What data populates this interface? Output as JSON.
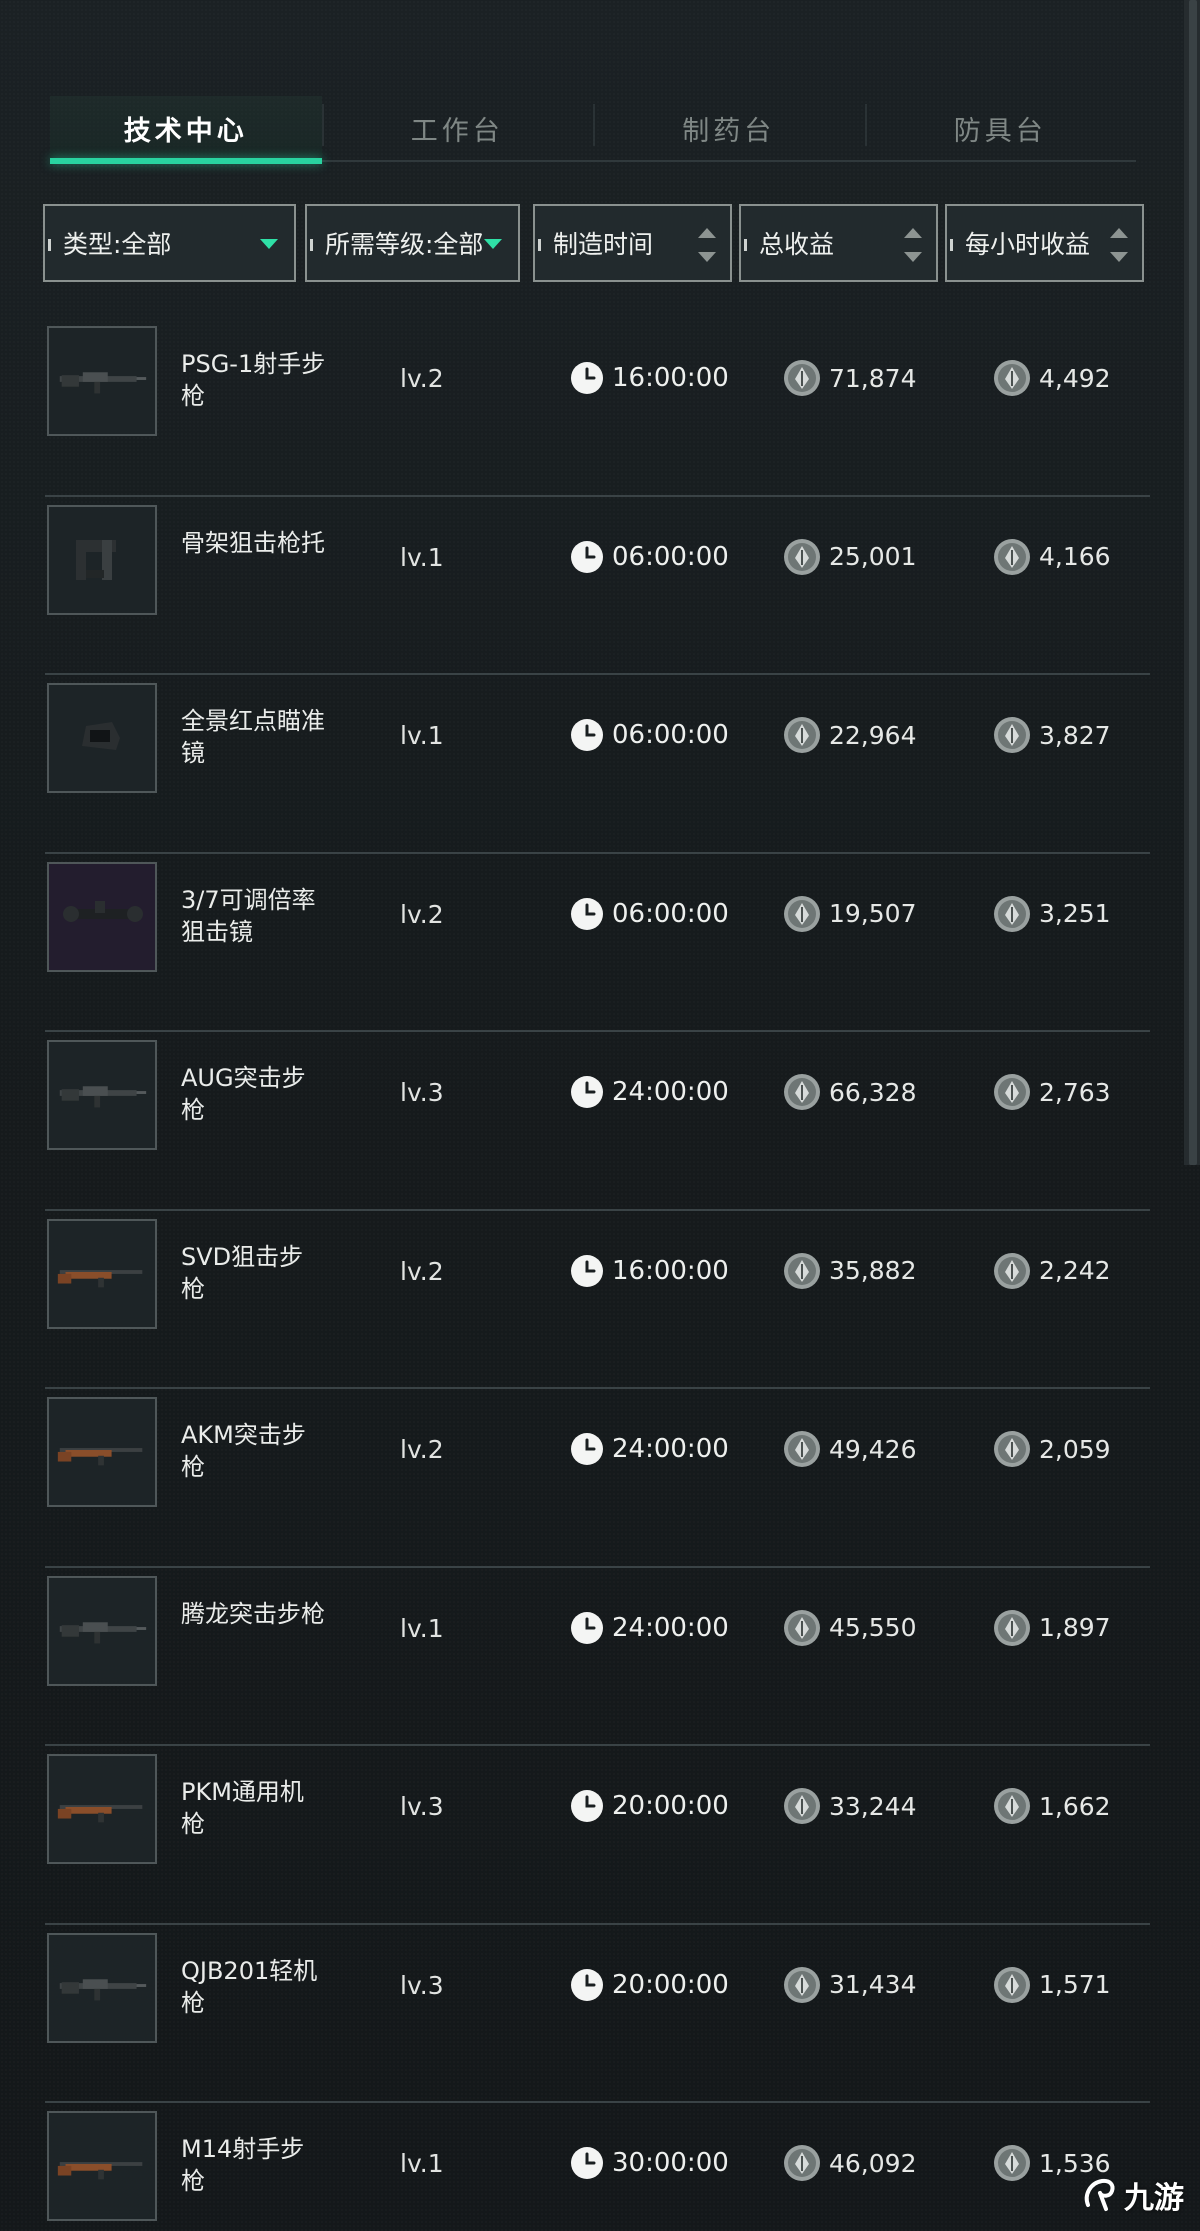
{
  "tabs": [
    {
      "label": "技术中心",
      "active": true
    },
    {
      "label": "工作台",
      "active": false
    },
    {
      "label": "制药台",
      "active": false
    },
    {
      "label": "防具台",
      "active": false
    }
  ],
  "filters": {
    "type": "类型:全部",
    "level": "所需等级:全部",
    "time": "制造时间",
    "total": "总收益",
    "hourly": "每小时收益"
  },
  "accent_color": "#29d3a0",
  "items": [
    {
      "name": "PSG-1射手步枪",
      "level": "lv.2",
      "time": "16:00:00",
      "total": "71,874",
      "hourly": "4,492",
      "icon": "psg1-rifle-icon"
    },
    {
      "name": "骨架狙击枪托",
      "level": "lv.1",
      "time": "06:00:00",
      "total": "25,001",
      "hourly": "4,166",
      "icon": "skeleton-stock-icon"
    },
    {
      "name": "全景红点瞄准镜",
      "level": "lv.1",
      "time": "06:00:00",
      "total": "22,964",
      "hourly": "3,827",
      "icon": "red-dot-sight-icon"
    },
    {
      "name": "3/7可调倍率狙击镜",
      "level": "lv.2",
      "time": "06:00:00",
      "total": "19,507",
      "hourly": "3,251",
      "icon": "sniper-scope-icon"
    },
    {
      "name": "AUG突击步枪",
      "level": "lv.3",
      "time": "24:00:00",
      "total": "66,328",
      "hourly": "2,763",
      "icon": "aug-rifle-icon"
    },
    {
      "name": "SVD狙击步枪",
      "level": "lv.2",
      "time": "16:00:00",
      "total": "35,882",
      "hourly": "2,242",
      "icon": "svd-rifle-icon"
    },
    {
      "name": "AKM突击步枪",
      "level": "lv.2",
      "time": "24:00:00",
      "total": "49,426",
      "hourly": "2,059",
      "icon": "akm-rifle-icon"
    },
    {
      "name": "腾龙突击步枪",
      "level": "lv.1",
      "time": "24:00:00",
      "total": "45,550",
      "hourly": "1,897",
      "icon": "tenglong-rifle-icon"
    },
    {
      "name": "PKM通用机枪",
      "level": "lv.3",
      "time": "20:00:00",
      "total": "33,244",
      "hourly": "1,662",
      "icon": "pkm-machinegun-icon"
    },
    {
      "name": "QJB201轻机枪",
      "level": "lv.3",
      "time": "20:00:00",
      "total": "31,434",
      "hourly": "1,571",
      "icon": "qjb201-machinegun-icon"
    },
    {
      "name": "M14射手步枪",
      "level": "lv.1",
      "time": "30:00:00",
      "total": "46,092",
      "hourly": "1,536",
      "icon": "m14-rifle-icon"
    }
  ],
  "watermark": "九游"
}
